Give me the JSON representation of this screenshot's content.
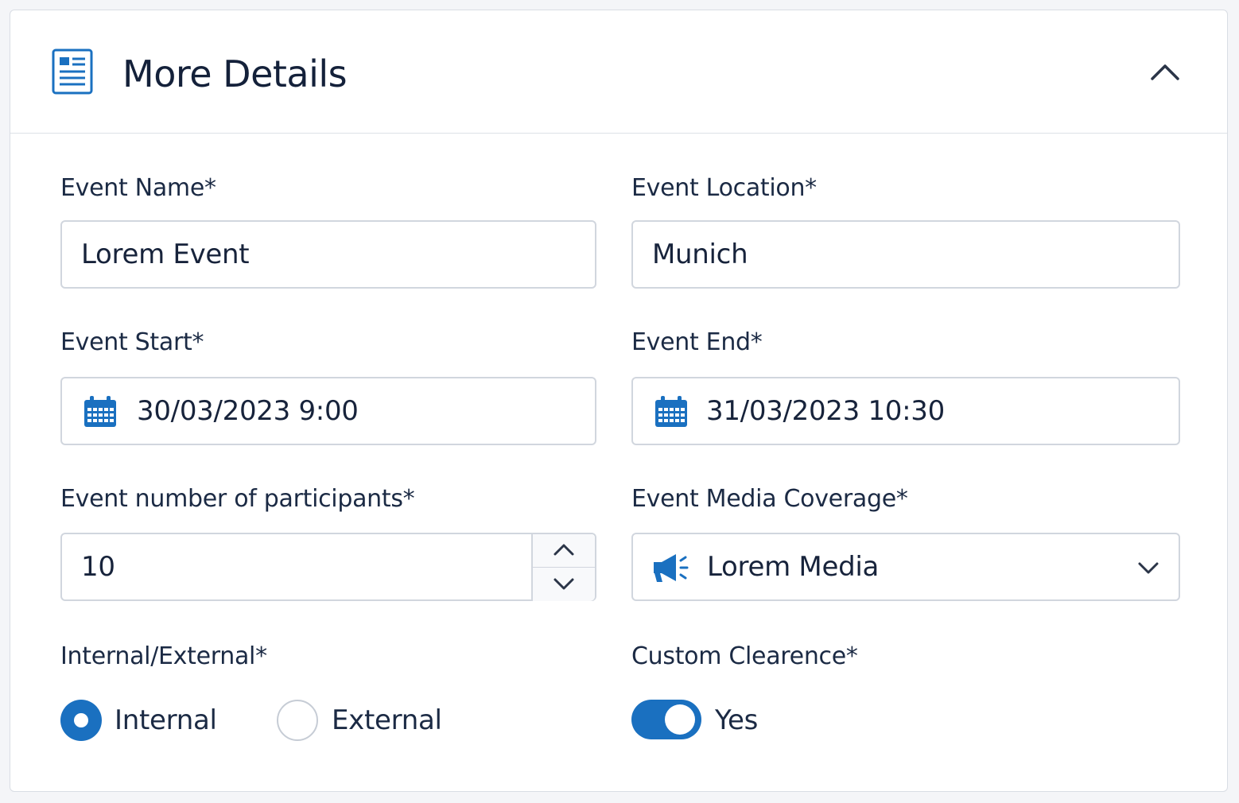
{
  "card": {
    "title": "More Details",
    "icon": "document-list-icon",
    "collapse_icon": "chevron-up-icon"
  },
  "fields": {
    "event_name": {
      "label": "Event Name*",
      "value": "Lorem Event"
    },
    "event_location": {
      "label": "Event Location*",
      "value": "Munich"
    },
    "event_start": {
      "label": "Event Start*",
      "value": "30/03/2023 9:00",
      "icon": "calendar-icon"
    },
    "event_end": {
      "label": "Event End*",
      "value": "31/03/2023 10:30",
      "icon": "calendar-icon"
    },
    "participants": {
      "label": "Event number of participants*",
      "value": "10"
    },
    "media_coverage": {
      "label": "Event Media Coverage*",
      "value": "Lorem Media",
      "icon": "megaphone-icon"
    },
    "internal_external": {
      "label": "Internal/External*",
      "options": [
        {
          "label": "Internal",
          "checked": true
        },
        {
          "label": "External",
          "checked": false
        }
      ]
    },
    "custom_clearence": {
      "label": "Custom Clearence*",
      "toggle_label": "Yes",
      "on": true
    }
  },
  "colors": {
    "accent": "#1a70c0",
    "text": "#16243d",
    "border": "#d1d6de"
  }
}
